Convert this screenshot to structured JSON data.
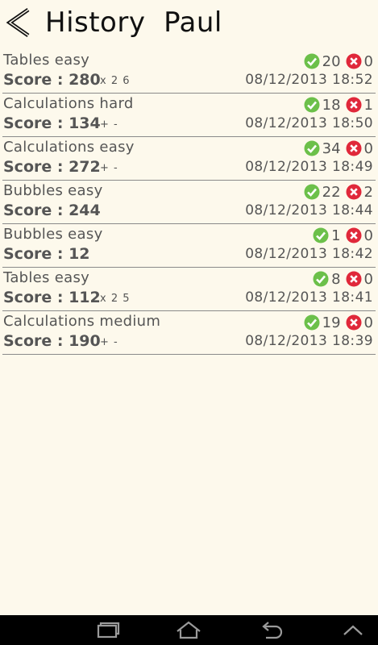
{
  "header": {
    "back_icon": "chevron-left-icon",
    "title": "History  Paul"
  },
  "colors": {
    "background": "#fdf9ec",
    "correct": "#6cc04a",
    "wrong": "#e0283a",
    "navbar": "#000000"
  },
  "history": [
    {
      "mode": "Tables easy",
      "score": "Score : 280",
      "extra": "x 2 6",
      "correct": "20",
      "wrong": "0",
      "date": "08/12/2013 18:52"
    },
    {
      "mode": "Calculations hard",
      "score": "Score : 134",
      "extra": "+ -",
      "correct": "18",
      "wrong": "1",
      "date": "08/12/2013 18:50"
    },
    {
      "mode": "Calculations easy",
      "score": "Score : 272",
      "extra": "+ -",
      "correct": "34",
      "wrong": "0",
      "date": "08/12/2013 18:49"
    },
    {
      "mode": "Bubbles easy",
      "score": "Score : 244",
      "extra": "",
      "correct": "22",
      "wrong": "2",
      "date": "08/12/2013 18:44"
    },
    {
      "mode": "Bubbles easy",
      "score": "Score : 12",
      "extra": "",
      "correct": "1",
      "wrong": "0",
      "date": "08/12/2013 18:42"
    },
    {
      "mode": "Tables easy",
      "score": "Score : 112",
      "extra": "x 2 5",
      "correct": "8",
      "wrong": "0",
      "date": "08/12/2013 18:41"
    },
    {
      "mode": "Calculations medium",
      "score": "Score : 190",
      "extra": "+ -",
      "correct": "19",
      "wrong": "0",
      "date": "08/12/2013 18:39"
    }
  ],
  "navbar": {
    "icons": [
      "recent-apps-icon",
      "home-icon",
      "back-arrow-icon",
      "chevron-up-icon"
    ]
  }
}
